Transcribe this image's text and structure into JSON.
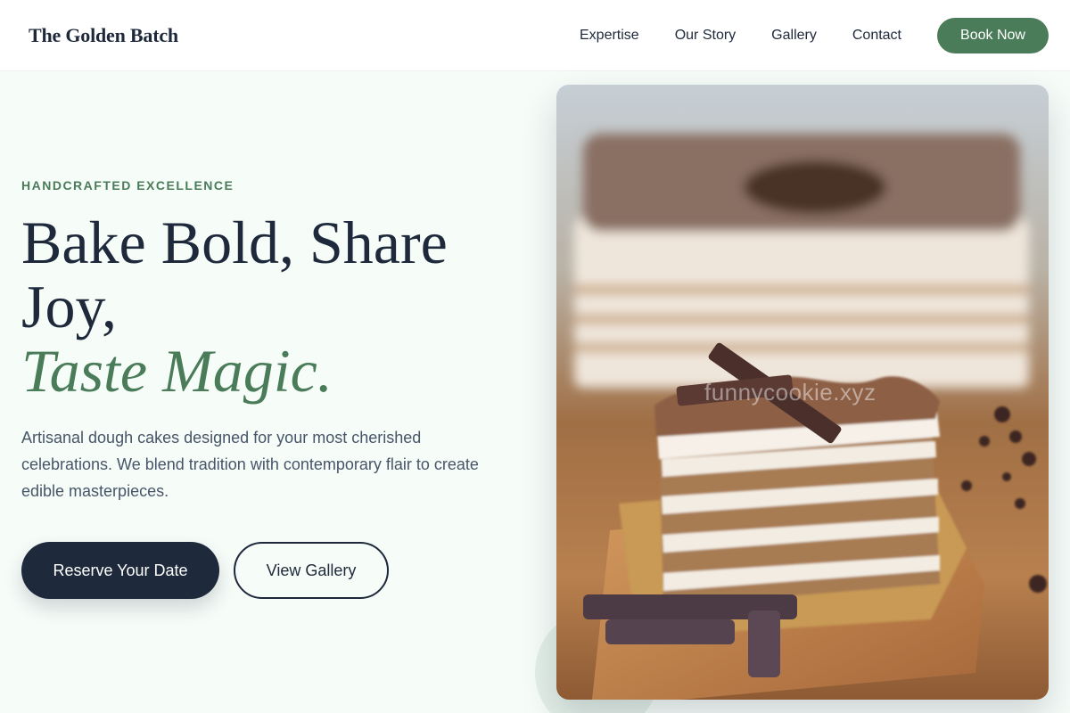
{
  "brand": {
    "name": "The Golden Batch"
  },
  "nav": {
    "links": [
      "Expertise",
      "Our Story",
      "Gallery",
      "Contact"
    ],
    "cta": "Book Now"
  },
  "hero": {
    "eyebrow": "HANDCRAFTED EXCELLENCE",
    "headline_line1": "Bake Bold, Share Joy,",
    "headline_accent": "Taste Magic.",
    "description": "Artisanal dough cakes designed for your most cherished celebrations. We blend tradition with contemporary flair to create edible masterpieces.",
    "primary_cta": "Reserve Your Date",
    "secondary_cta": "View Gallery"
  },
  "image": {
    "subject": "layered tiramisu cake slice with chocolate sticks",
    "watermark": "funnycookie.xyz"
  },
  "colors": {
    "accent": "#4a7c59",
    "dark": "#1e293b",
    "muted_text": "#475569",
    "background": "#f6fcf8"
  }
}
